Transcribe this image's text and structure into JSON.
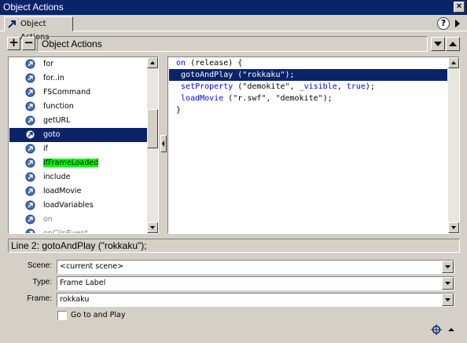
{
  "window": {
    "title": "Object Actions",
    "close_glyph": "×"
  },
  "tab": {
    "label": "Object Actions",
    "icon": "arrow-icon"
  },
  "help": {
    "glyph": "?"
  },
  "toolbar": {
    "add_glyph": "+",
    "remove_glyph": "−",
    "title": "Object Actions"
  },
  "actions_list": {
    "items": [
      {
        "label": "for"
      },
      {
        "label": "for..in"
      },
      {
        "label": "FSCommand"
      },
      {
        "label": "function"
      },
      {
        "label": "getURL"
      },
      {
        "label": "goto",
        "selected": true
      },
      {
        "label": "if"
      },
      {
        "label": "ifFrameLoaded",
        "highlight": true
      },
      {
        "label": "include"
      },
      {
        "label": "loadMovie"
      },
      {
        "label": "loadVariables"
      },
      {
        "label": "on",
        "dim": true
      },
      {
        "label": "onClipEvent",
        "dim": true
      }
    ]
  },
  "code": {
    "lines": [
      {
        "text": "on (release) {"
      },
      {
        "text": " gotoAndPlay (\"rokkaku\");",
        "selected": true
      },
      {
        "text": " setProperty (\"demokite\", _visible, true);"
      },
      {
        "text": " loadMovie (\"r.swf\", \"demokite\");"
      },
      {
        "text": "}"
      }
    ]
  },
  "status": {
    "text": "Line 2: gotoAndPlay (\"rokkaku\");"
  },
  "params": {
    "scene": {
      "label": "Scene:",
      "value": "<current scene>"
    },
    "type": {
      "label": "Type:",
      "value": "Frame Label"
    },
    "frame": {
      "label": "Frame:",
      "value": "rokkaku"
    },
    "go_to_and_play": {
      "label": "Go to and Play",
      "checked": false
    }
  },
  "colors": {
    "selection": "#0a246a",
    "highlight": "#00ff00",
    "keyword": "#0000ff",
    "face": "#d4d0c8"
  }
}
